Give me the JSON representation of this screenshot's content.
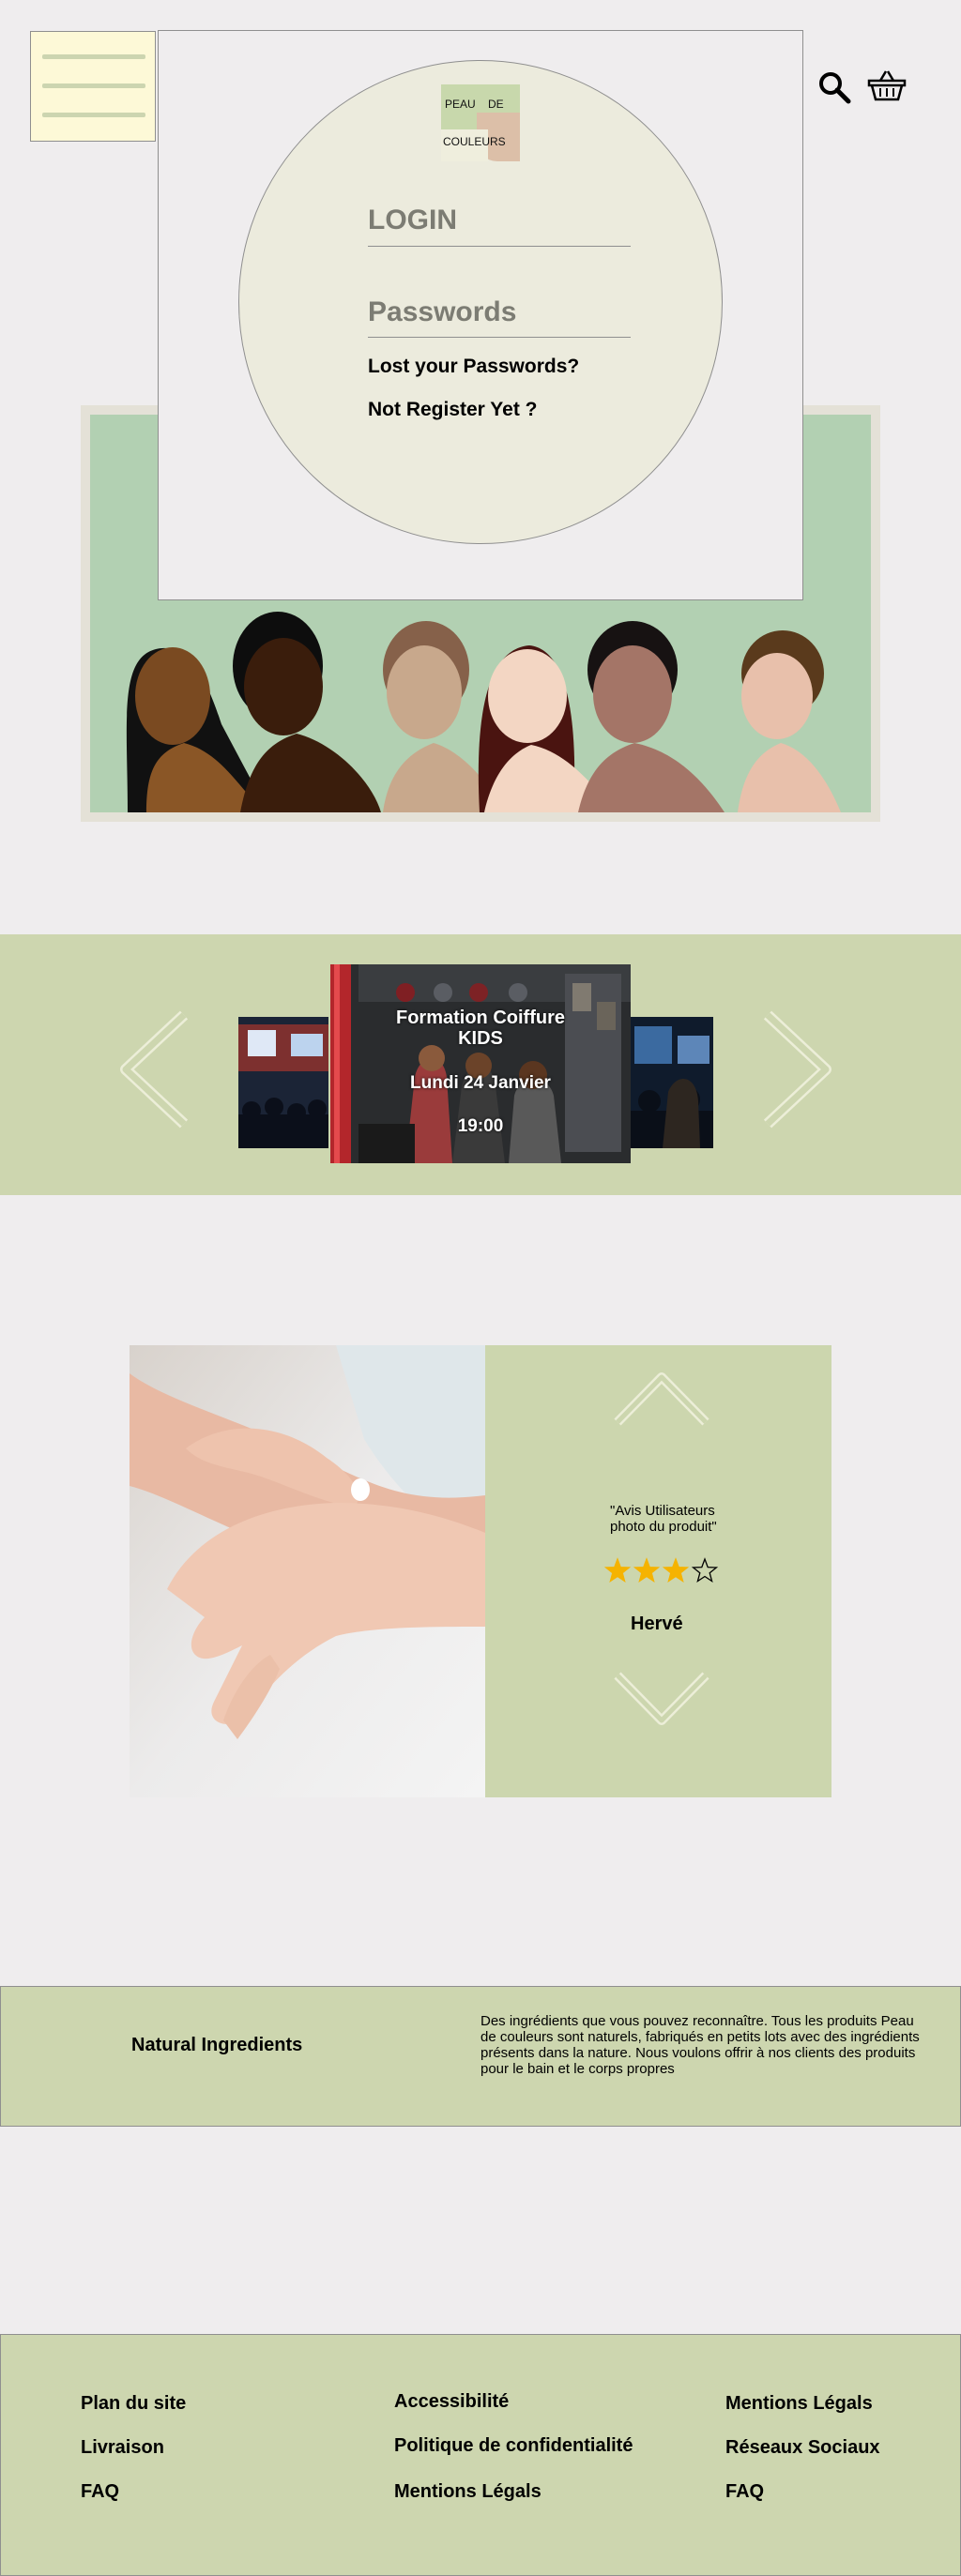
{
  "header": {
    "menu_icon": "hamburger-menu-icon",
    "search_icon": "search-icon",
    "cart_icon": "basket-icon"
  },
  "login_modal": {
    "logo_text_1": "PEAU",
    "logo_text_2": "DE",
    "logo_text_3": "COULEURS",
    "login_label": "LOGIN",
    "password_label": "Passwords",
    "lost_password_link": "Lost your Passwords?",
    "register_link": "Not Register Yet ?"
  },
  "carousel": {
    "event_title": "Formation Coiffure KIDS",
    "event_date": "Lundi 24 Janvier",
    "event_time": "19:00",
    "prev_icon": "chevron-left-icon",
    "next_icon": "chevron-right-icon"
  },
  "review": {
    "quote": "\"Avis Utilisateurs photo du produit\"",
    "rating": 3,
    "rating_max": 4,
    "reviewer": "Hervé",
    "up_icon": "chevron-up-icon",
    "down_icon": "chevron-down-icon"
  },
  "natural": {
    "title": "Natural Ingredients",
    "text": "Des ingrédients que vous pouvez reconnaître. Tous les produits Peau de couleurs sont naturels, fabriqués en petits lots avec des ingrédients présents dans la nature. Nous voulons offrir à nos clients des produits pour le bain et le corps propres"
  },
  "footer": {
    "col1": [
      "Plan du site",
      "Livraison",
      "FAQ"
    ],
    "col2": [
      "Accessibilité",
      "Politique de confidentialité",
      "Mentions Légals"
    ],
    "col3": [
      "Mentions Légals",
      "Réseaux Sociaux",
      "FAQ"
    ]
  },
  "colors": {
    "background": "#efedee",
    "accent_green": "#cdd6af",
    "hero_green": "#b2d0b2",
    "menu_yellow": "#fdf9d7",
    "star": "#f5b301"
  }
}
